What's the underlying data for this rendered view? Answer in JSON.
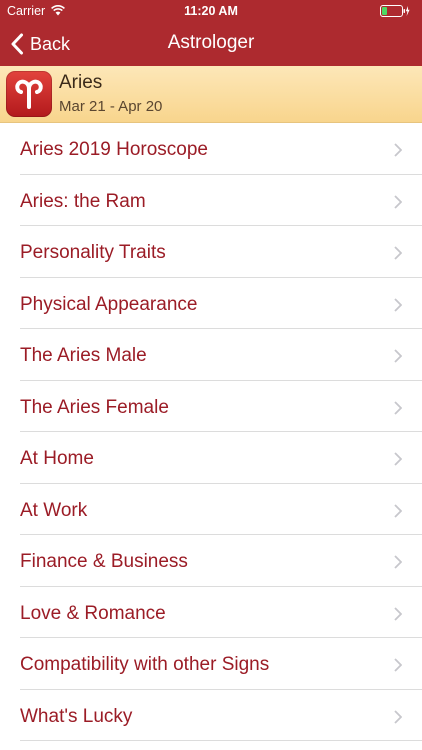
{
  "status_bar": {
    "carrier": "Carrier",
    "time": "11:20 AM"
  },
  "nav": {
    "back_label": "Back",
    "title": "Astrologer"
  },
  "sign": {
    "name": "Aries",
    "dates": "Mar 21 - Apr 20",
    "icon": "aries-symbol-icon"
  },
  "menu": {
    "items": [
      {
        "label": "Aries 2019 Horoscope"
      },
      {
        "label": "Aries: the Ram"
      },
      {
        "label": "Personality Traits"
      },
      {
        "label": "Physical Appearance"
      },
      {
        "label": "The Aries Male"
      },
      {
        "label": "The Aries Female"
      },
      {
        "label": "At Home"
      },
      {
        "label": "At Work"
      },
      {
        "label": "Finance & Business"
      },
      {
        "label": "Love & Romance"
      },
      {
        "label": "Compatibility with other Signs"
      },
      {
        "label": "What's Lucky"
      }
    ]
  },
  "colors": {
    "nav_background": "#ad2a2f",
    "menu_text": "#9b1c26",
    "header_background": "#f8d58d"
  }
}
